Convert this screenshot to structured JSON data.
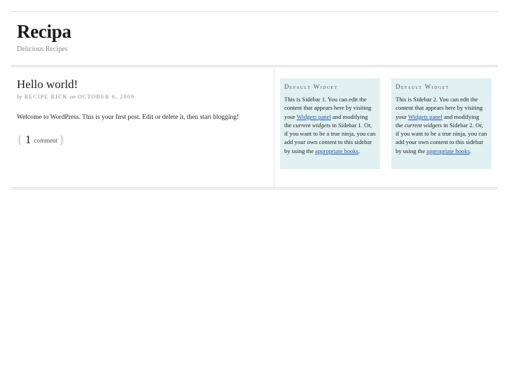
{
  "site": {
    "title": "Recipa",
    "tagline": "Delicious Recipes"
  },
  "post": {
    "title": "Hello world!",
    "meta_by": "by",
    "author": "RECIPE RICK",
    "meta_on": "on",
    "date": "OCTOBER 6, 2009",
    "content": "Welcome to WordPress. This is your first post. Edit or delete it, then start blogging!",
    "comment_open": "{",
    "comment_count": "1",
    "comment_label": "comment",
    "comment_close": "}"
  },
  "sidebars": [
    {
      "title": "Default Widget",
      "text_1": "This is Sidebar 1. You can edit the content that appears here by visiting your ",
      "link_1": "Widgets panel",
      "text_2": " and modifying the ",
      "em": "current widgets",
      "text_3": " in Sidebar 1. Or, if you want to be a true ninja, you can add your own content to this sidebar by using the ",
      "link_2": "appropriate hooks",
      "text_4": "."
    },
    {
      "title": "Default Widget",
      "text_1": "This is Sidebar 2. You can edit the content that appears here by visiting your ",
      "link_1": "Widgets panel",
      "text_2": " and modifying the ",
      "em": "current widgets",
      "text_3": " in Sidebar 2. Or, if you want to be a true ninja, you can add your own content to this sidebar by using the ",
      "link_2": "appropriate hooks",
      "text_4": "."
    }
  ]
}
